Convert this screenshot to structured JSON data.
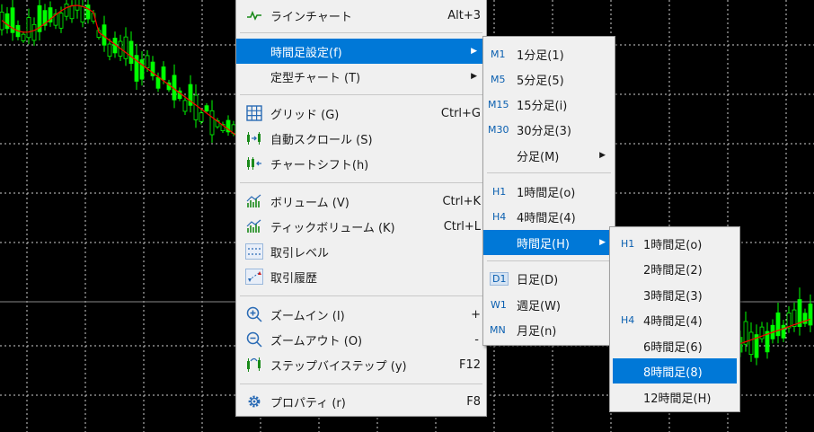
{
  "main_menu": {
    "line_chart": {
      "label": "ラインチャート",
      "shortcut": "Alt+3"
    },
    "timeframe": {
      "label": "時間足設定(f)"
    },
    "template": {
      "label": "定型チャート (T)"
    },
    "grid": {
      "label": "グリッド (G)",
      "shortcut": "Ctrl+G"
    },
    "autoscroll": {
      "label": "自動スクロール (S)"
    },
    "chart_shift": {
      "label": "チャートシフト(h)"
    },
    "volume": {
      "label": "ボリューム (V)",
      "shortcut": "Ctrl+K"
    },
    "tick_volume": {
      "label": "ティックボリューム (K)",
      "shortcut": "Ctrl+L"
    },
    "trade_levels": {
      "label": "取引レベル"
    },
    "trade_history": {
      "label": "取引履歴"
    },
    "zoom_in": {
      "label": "ズームイン (I)",
      "shortcut": "+"
    },
    "zoom_out": {
      "label": "ズームアウト (O)",
      "shortcut": "-"
    },
    "step": {
      "label": "ステップバイステップ (y)",
      "shortcut": "F12"
    },
    "properties": {
      "label": "プロパティ (r)",
      "shortcut": "F8"
    }
  },
  "timeframe_menu": {
    "items": [
      {
        "tag": "M1",
        "label": "1分足(1)"
      },
      {
        "tag": "M5",
        "label": "5分足(5)"
      },
      {
        "tag": "M15",
        "label": "15分足(i)"
      },
      {
        "tag": "M30",
        "label": "30分足(3)"
      },
      {
        "tag": "",
        "label": "分足(M)"
      },
      {
        "tag": "H1",
        "label": "1時間足(o)"
      },
      {
        "tag": "H4",
        "label": "4時間足(4)"
      },
      {
        "tag": "",
        "label": "時間足(H)"
      },
      {
        "tag": "D1",
        "label": "日足(D)"
      },
      {
        "tag": "W1",
        "label": "週足(W)"
      },
      {
        "tag": "MN",
        "label": "月足(n)"
      }
    ]
  },
  "hour_menu": {
    "items": [
      {
        "tag": "H1",
        "label": "1時間足(o)"
      },
      {
        "tag": "",
        "label": "2時間足(2)"
      },
      {
        "tag": "",
        "label": "3時間足(3)"
      },
      {
        "tag": "H4",
        "label": "4時間足(4)"
      },
      {
        "tag": "",
        "label": "6時間足(6)"
      },
      {
        "tag": "",
        "label": "8時間足(8)"
      },
      {
        "tag": "",
        "label": "12時間足(H)"
      }
    ]
  },
  "colors": {
    "chart_bg": "#000000",
    "grid": "#cfcfcf",
    "candle": "#00ff00",
    "moving_average": "#ff0000",
    "menu_bg": "#f0f0f0",
    "highlight": "#0078d7"
  }
}
